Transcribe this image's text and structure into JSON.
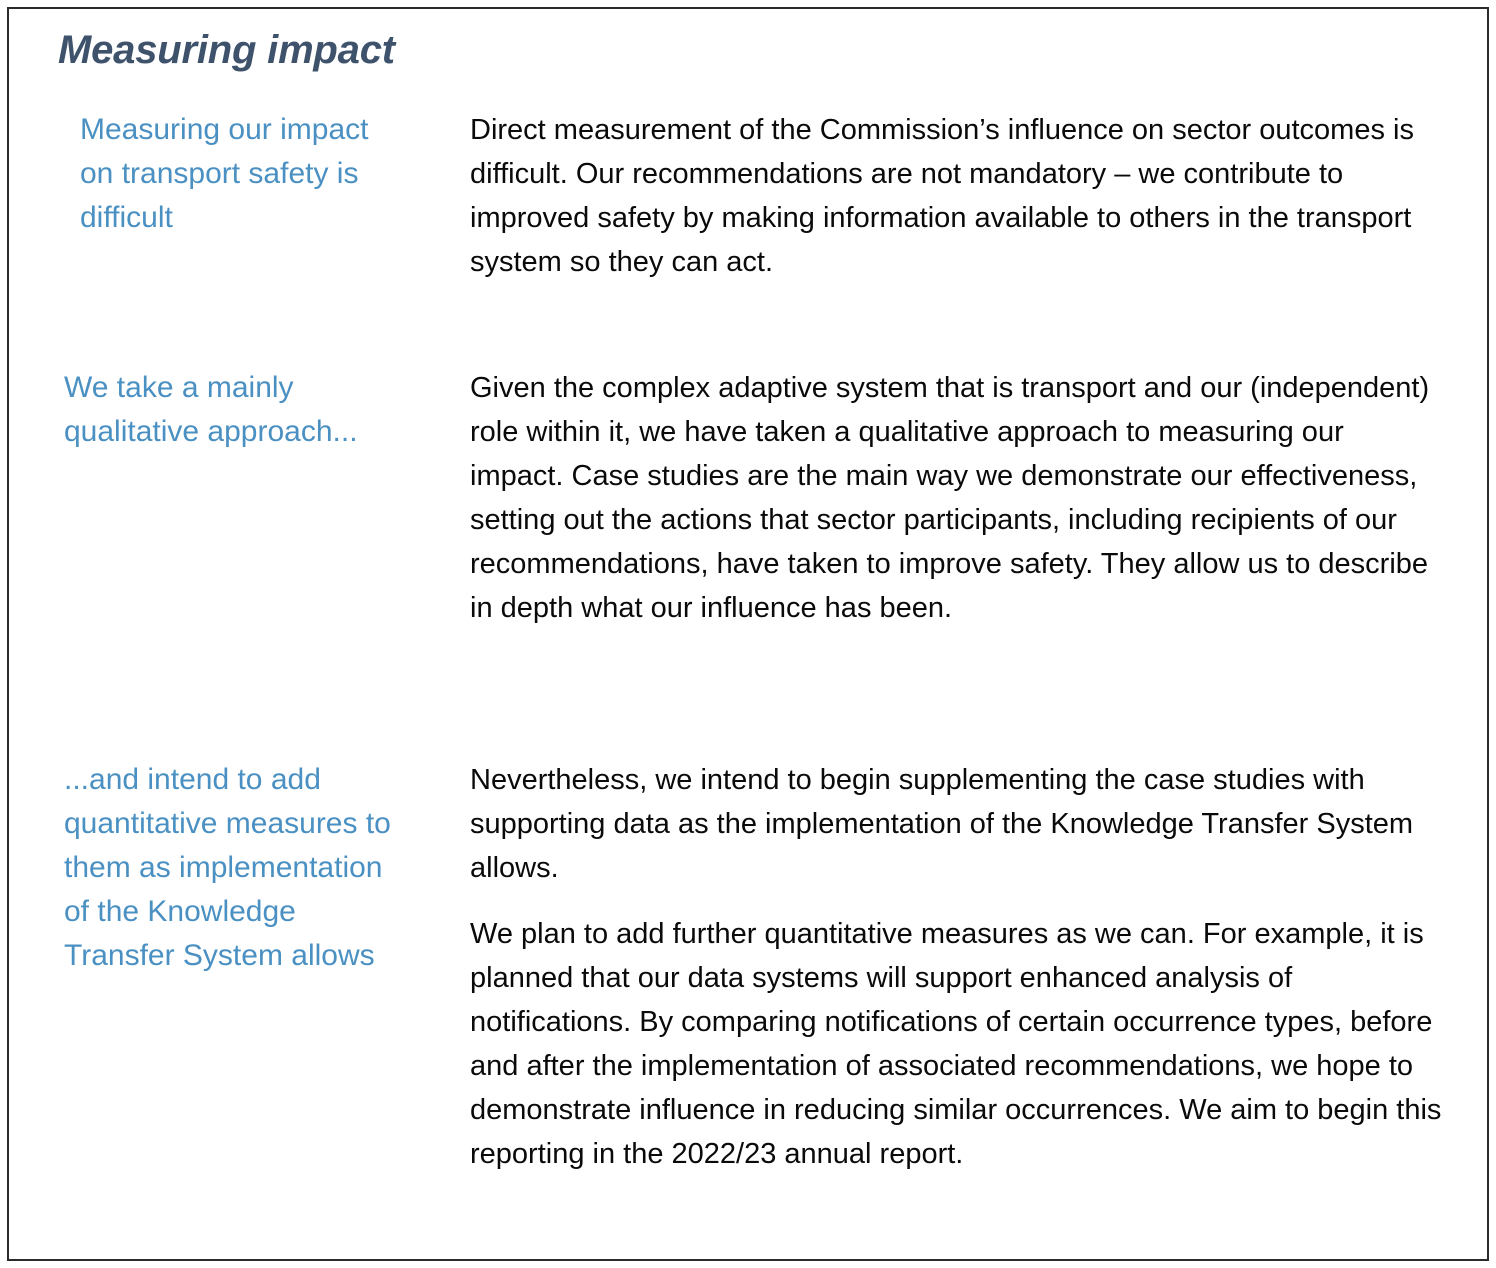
{
  "document": {
    "title": "Measuring impact",
    "colors": {
      "title": "#3f526b",
      "sidebar_heading": "#4a90c2",
      "body_text": "#0a0a0a",
      "border": "#2b2b2b",
      "background": "#ffffff"
    }
  },
  "sections": [
    {
      "heading": "Measuring our impact on transport safety is difficult",
      "paragraphs": [
        "Direct measurement of the Commission’s influence on sector outcomes is difficult. Our recommendations are not mandatory – we contribute to improved safety by making information available to others in the transport system so they can act."
      ]
    },
    {
      "heading": "We take a mainly qualitative approach...",
      "paragraphs": [
        "Given the complex adaptive system that is transport and our (independent) role within it, we have taken a qualitative approach to measuring our impact. Case studies are the main way we demonstrate our effectiveness, setting out the actions that sector participants, including recipients of our recommendations, have taken to improve safety. They allow us to describe in depth what our influence has been."
      ]
    },
    {
      "heading": "...and intend to add quantitative measures to them as implementation of the Knowledge Transfer System allows",
      "paragraphs": [
        "Nevertheless, we intend to begin supplementing the case studies with supporting data as the implementation of the Knowledge Transfer System allows.",
        "We plan to add further quantitative measures as we can. For example, it is planned that our data systems will support enhanced analysis of notifications. By comparing notifications of certain occurrence types, before and after the implementation of associated recommendations, we hope to demonstrate influence in reducing similar occurrences. We aim to begin this reporting in the 2022/23 annual report."
      ]
    }
  ]
}
